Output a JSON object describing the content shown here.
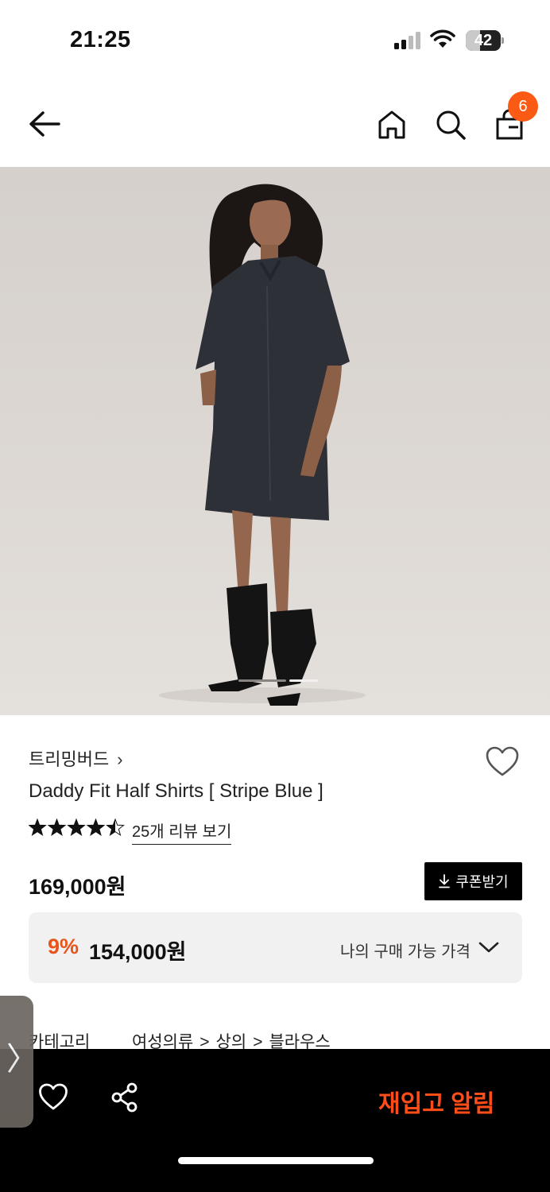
{
  "status_bar": {
    "time": "21:25",
    "battery": "42",
    "battery_level": 0.42
  },
  "nav": {
    "back_icon": "arrow-left-icon",
    "home_icon": "home-icon",
    "search_icon": "search-icon",
    "cart_icon": "shopping-bag-icon",
    "cart_count": "6",
    "badge_color": "#fb5a14"
  },
  "hero": {
    "image_icon": "model-photo",
    "slide_count": 2,
    "active_slide": 1
  },
  "product": {
    "brand": "트리밍버드",
    "brand_chevron": "›",
    "title": "Daddy Fit Half Shirts [ Stripe Blue ]",
    "rating": 4.5,
    "rating_max": 5,
    "review_link": "25개 리뷰 보기",
    "price": "169,000원",
    "coupon_button": "쿠폰받기",
    "discount_rate": "9%",
    "sale_price": "154,000원",
    "my_price_label": "나의 구매 가능 가격",
    "category_label": "카테고리",
    "category_path": [
      "여성의류",
      "상의",
      "블라우스"
    ],
    "category_separator": ">",
    "accent_color": "#e8541a"
  },
  "side_tab": {
    "arrow": "〉"
  },
  "bottom_bar": {
    "wishlist_icon": "heart-outline-icon",
    "share_icon": "share-icon",
    "restock_label": "재입고 알림",
    "restock_color": "#ff4d1a"
  }
}
